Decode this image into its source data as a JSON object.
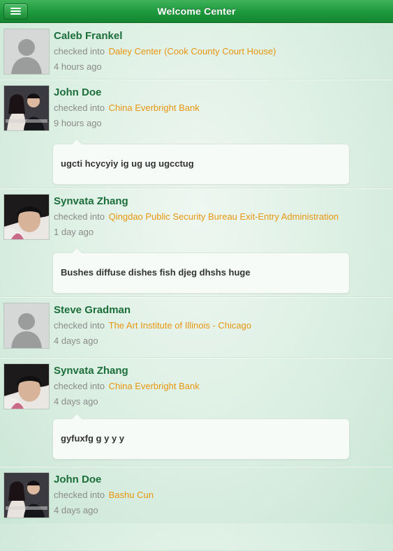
{
  "header": {
    "title": "Welcome Center",
    "menu_icon": "hamburger-menu-icon"
  },
  "feed": {
    "items": [
      {
        "name": "Caleb Frankel",
        "checked_label": "checked into",
        "place": "Daley Center (Cook County Court House)",
        "time": "4 hours ago",
        "comment": "",
        "avatar": "default-avatar-icon"
      },
      {
        "name": "John Doe",
        "checked_label": "checked into",
        "place": "China Everbright Bank",
        "time": "9 hours ago",
        "comment": "ugcti hcycyiy ig ug ug ugcctug",
        "avatar": "user-photo"
      },
      {
        "name": "Synvata Zhang",
        "checked_label": "checked into",
        "place": "Qingdao Public Security Bureau Exit-Entry Administration",
        "time": "1 day ago",
        "comment": "Bushes diffuse dishes fish djeg dhshs huge",
        "avatar": "user-photo"
      },
      {
        "name": "Steve Gradman",
        "checked_label": "checked into",
        "place": "The Art Institute of Illinois - Chicago",
        "time": "4 days ago",
        "comment": "",
        "avatar": "default-avatar-icon"
      },
      {
        "name": "Synvata Zhang",
        "checked_label": "checked into",
        "place": "China Everbright Bank",
        "time": "4 days ago",
        "comment": "gyfuxfg g y y y",
        "avatar": "user-photo"
      },
      {
        "name": "John Doe",
        "checked_label": "checked into",
        "place": "Bashu Cun",
        "time": "4 days ago",
        "comment": "",
        "avatar": "user-photo"
      }
    ]
  },
  "colors": {
    "nav_green": "#1f9b3e",
    "name_green": "#1b6e3a",
    "place_orange": "#e79610",
    "muted_gray": "#8a8a8a"
  }
}
